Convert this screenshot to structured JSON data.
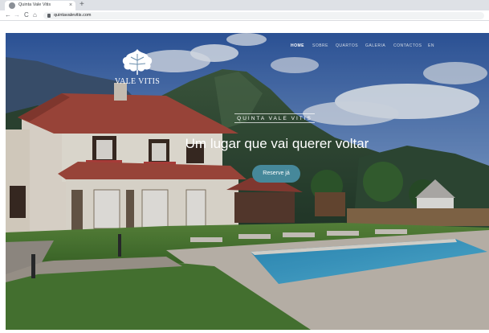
{
  "browser": {
    "tab_title": "Quinta Vale Vitis",
    "tab_close": "×",
    "new_tab": "+",
    "back": "←",
    "forward": "→",
    "reload": "C",
    "home": "⌂",
    "url": "quintavalevitis.com"
  },
  "site": {
    "logo_text": "VALE VITIS",
    "nav": [
      "HOME",
      "SOBRE",
      "QUARTOS",
      "GALERIA",
      "CONTACTOS",
      "EN"
    ],
    "eyebrow": "QUINTA VALE VITIS",
    "headline": "Um lugar que vai querer voltar",
    "cta": "Reserve já"
  },
  "colors": {
    "cta": "#46889a",
    "pool": "#3fa0c8",
    "roof": "#a8493a",
    "sky": "#3f68a8"
  }
}
